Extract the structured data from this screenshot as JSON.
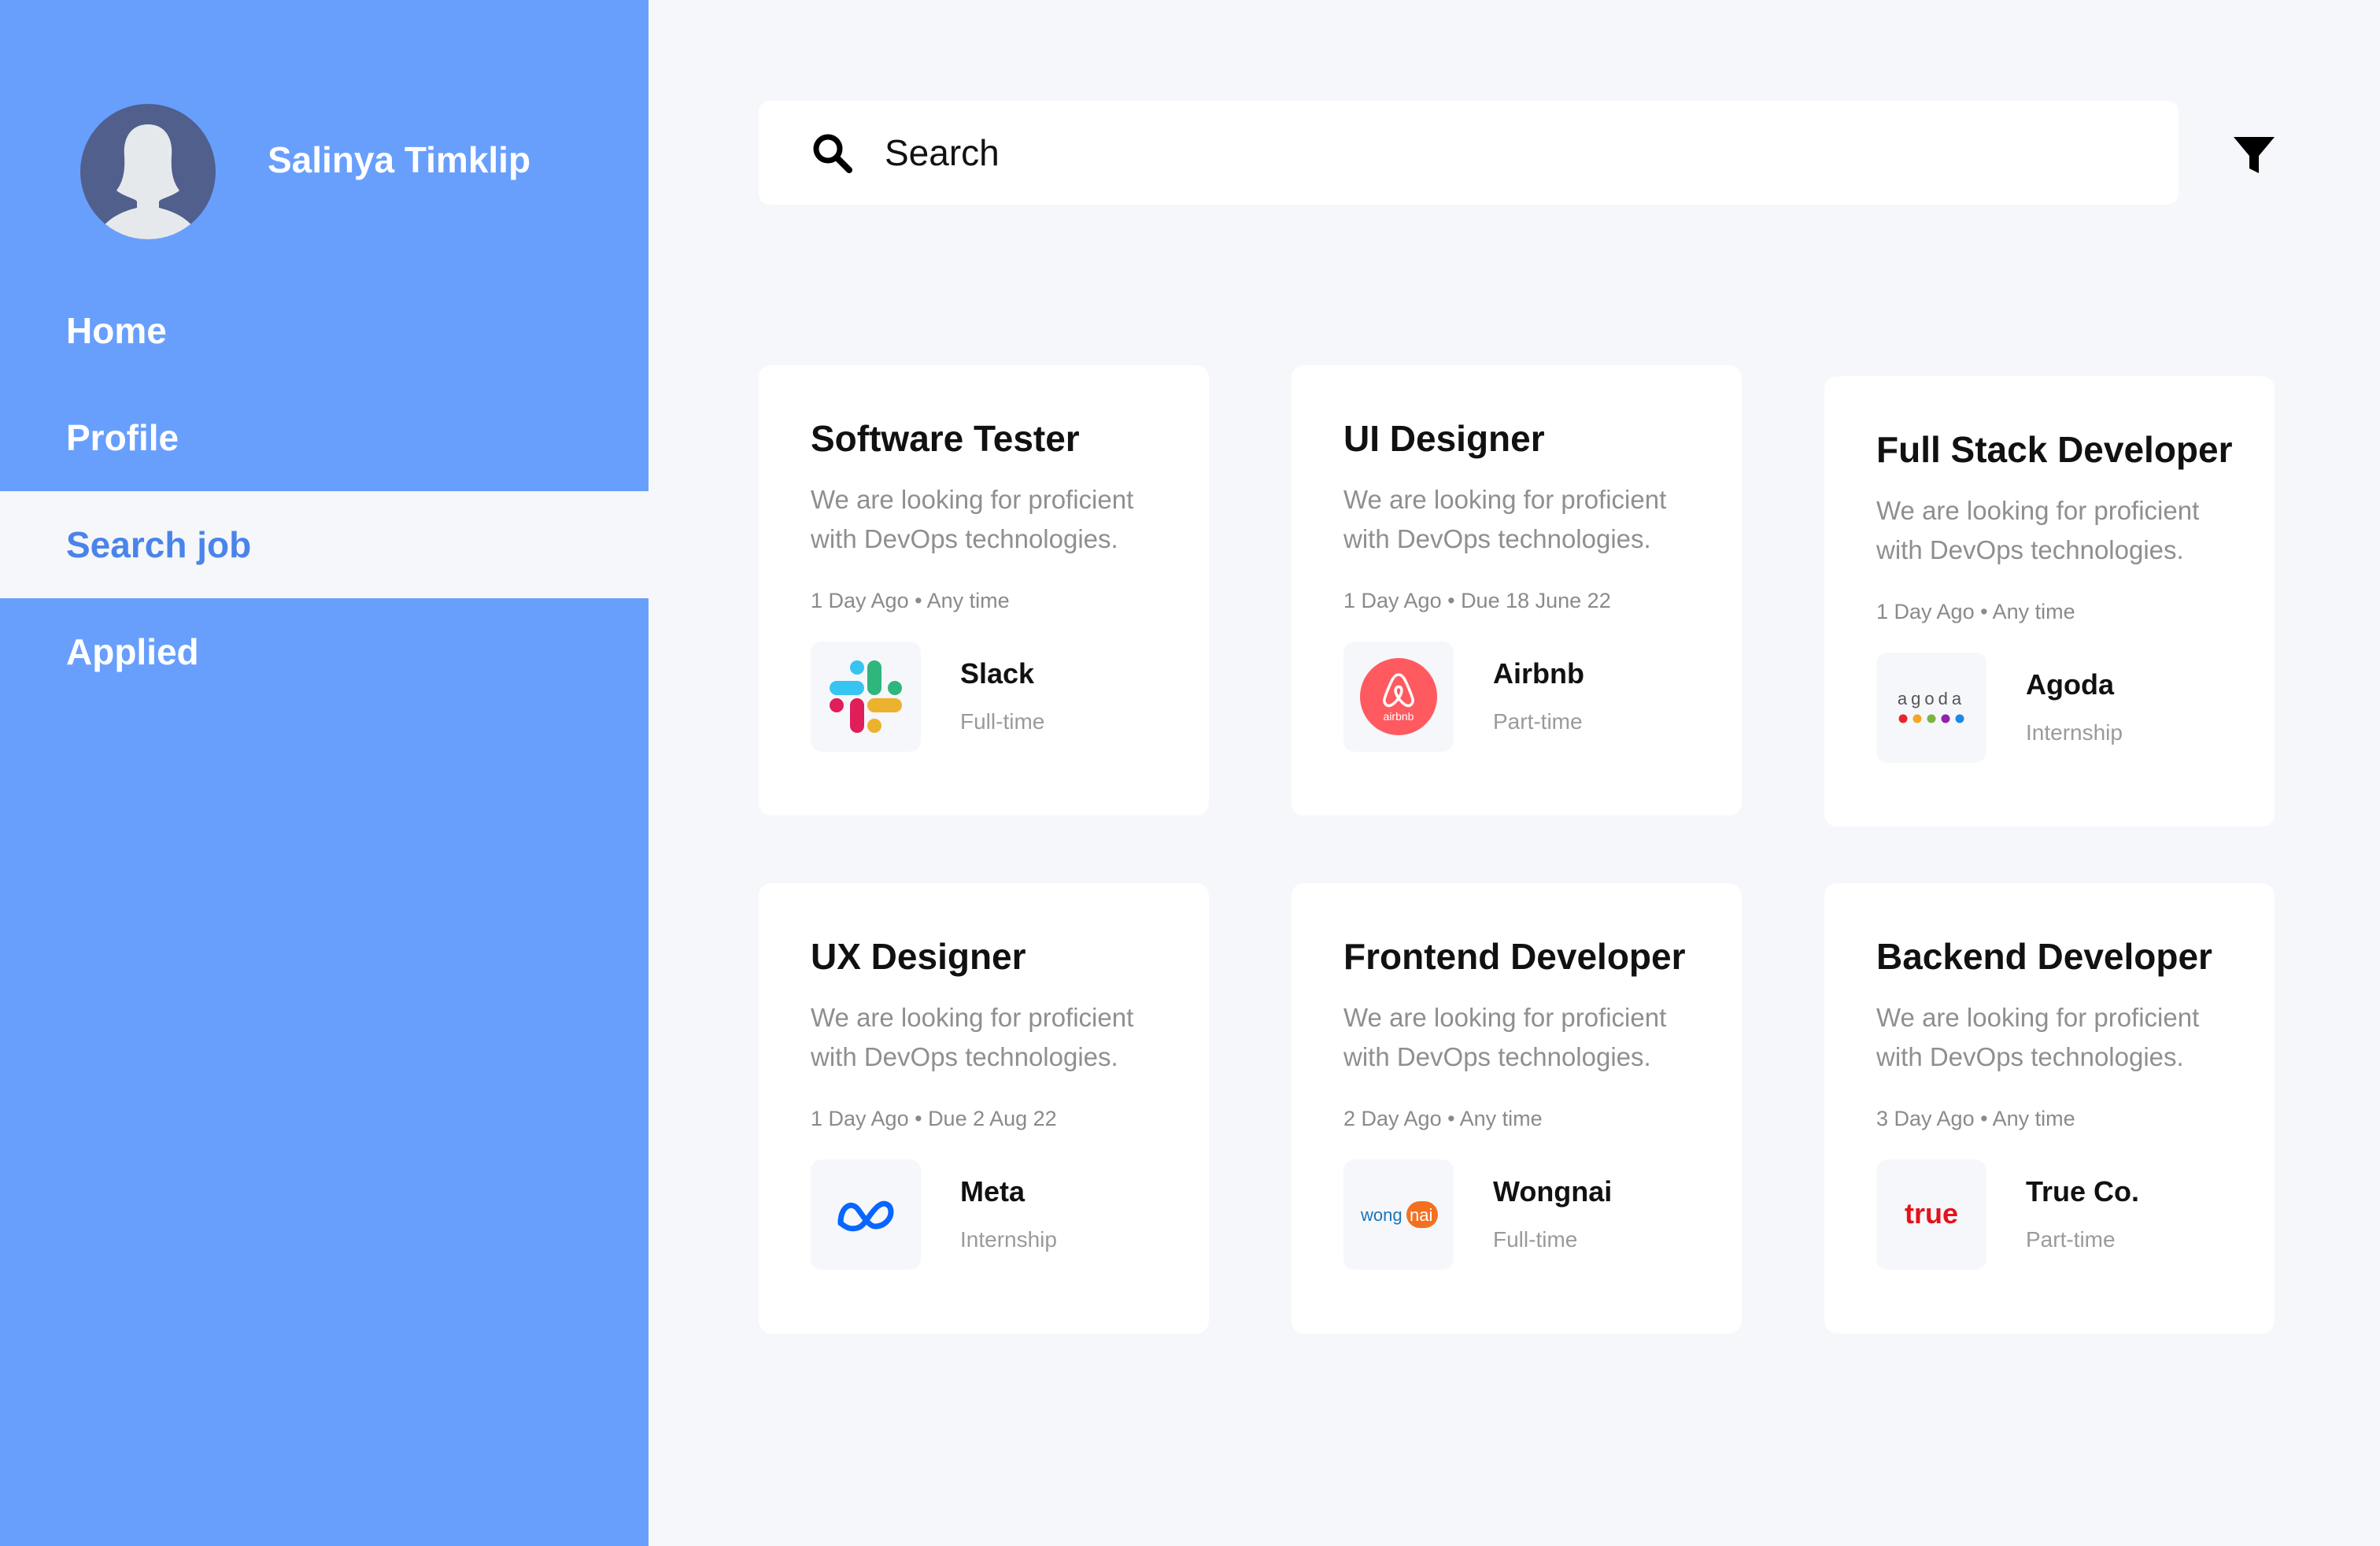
{
  "sidebar": {
    "user_name": "Salinya Timklip",
    "nav": [
      {
        "label": "Home",
        "active": false
      },
      {
        "label": "Profile",
        "active": false
      },
      {
        "label": "Search job",
        "active": true
      },
      {
        "label": "Applied",
        "active": false
      }
    ],
    "colors": {
      "background": "#689ffd",
      "active_text": "#4a84ea"
    }
  },
  "search": {
    "placeholder": "Search",
    "icon": "search-icon"
  },
  "filter": {
    "icon": "filter-icon"
  },
  "jobs": [
    {
      "title": "Software Tester",
      "desc": "We are looking for proficient with DevOps technologies.",
      "posted": "1 Day Ago",
      "due": "Any time",
      "company": "Slack",
      "type": "Full-time",
      "logo": "slack-logo"
    },
    {
      "title": "UI Designer",
      "desc": "We are looking for proficient with DevOps technologies.",
      "posted": "1 Day Ago",
      "due": "Due 18 June 22",
      "company": "Airbnb",
      "type": "Part-time",
      "logo": "airbnb-logo",
      "logo_text": "airbnb"
    },
    {
      "title": "Full Stack Developer",
      "desc": "We are looking for proficient with DevOps technologies.",
      "posted": "1 Day Ago",
      "due": "Any time",
      "company": "Agoda",
      "type": "Internship",
      "logo": "agoda-logo",
      "logo_text": "agoda"
    },
    {
      "title": "UX Designer",
      "desc": "We are looking for proficient with DevOps technologies.",
      "posted": "1 Day Ago",
      "due": "Due 2 Aug 22",
      "company": "Meta",
      "type": "Internship",
      "logo": "meta-logo"
    },
    {
      "title": "Frontend Developer",
      "desc": "We are looking for proficient with DevOps technologies.",
      "posted": "2 Day Ago",
      "due": "Any time",
      "company": "Wongnai",
      "type": "Full-time",
      "logo": "wongnai-logo",
      "logo_text_a": "wong",
      "logo_text_b": "nai"
    },
    {
      "title": "Backend Developer",
      "desc": "We are looking for proficient with DevOps technologies.",
      "posted": "3 Day Ago",
      "due": "Any time",
      "company": "True Co.",
      "type": "Part-time",
      "logo": "true-logo",
      "logo_text": "true"
    }
  ],
  "meta_separator": " • "
}
